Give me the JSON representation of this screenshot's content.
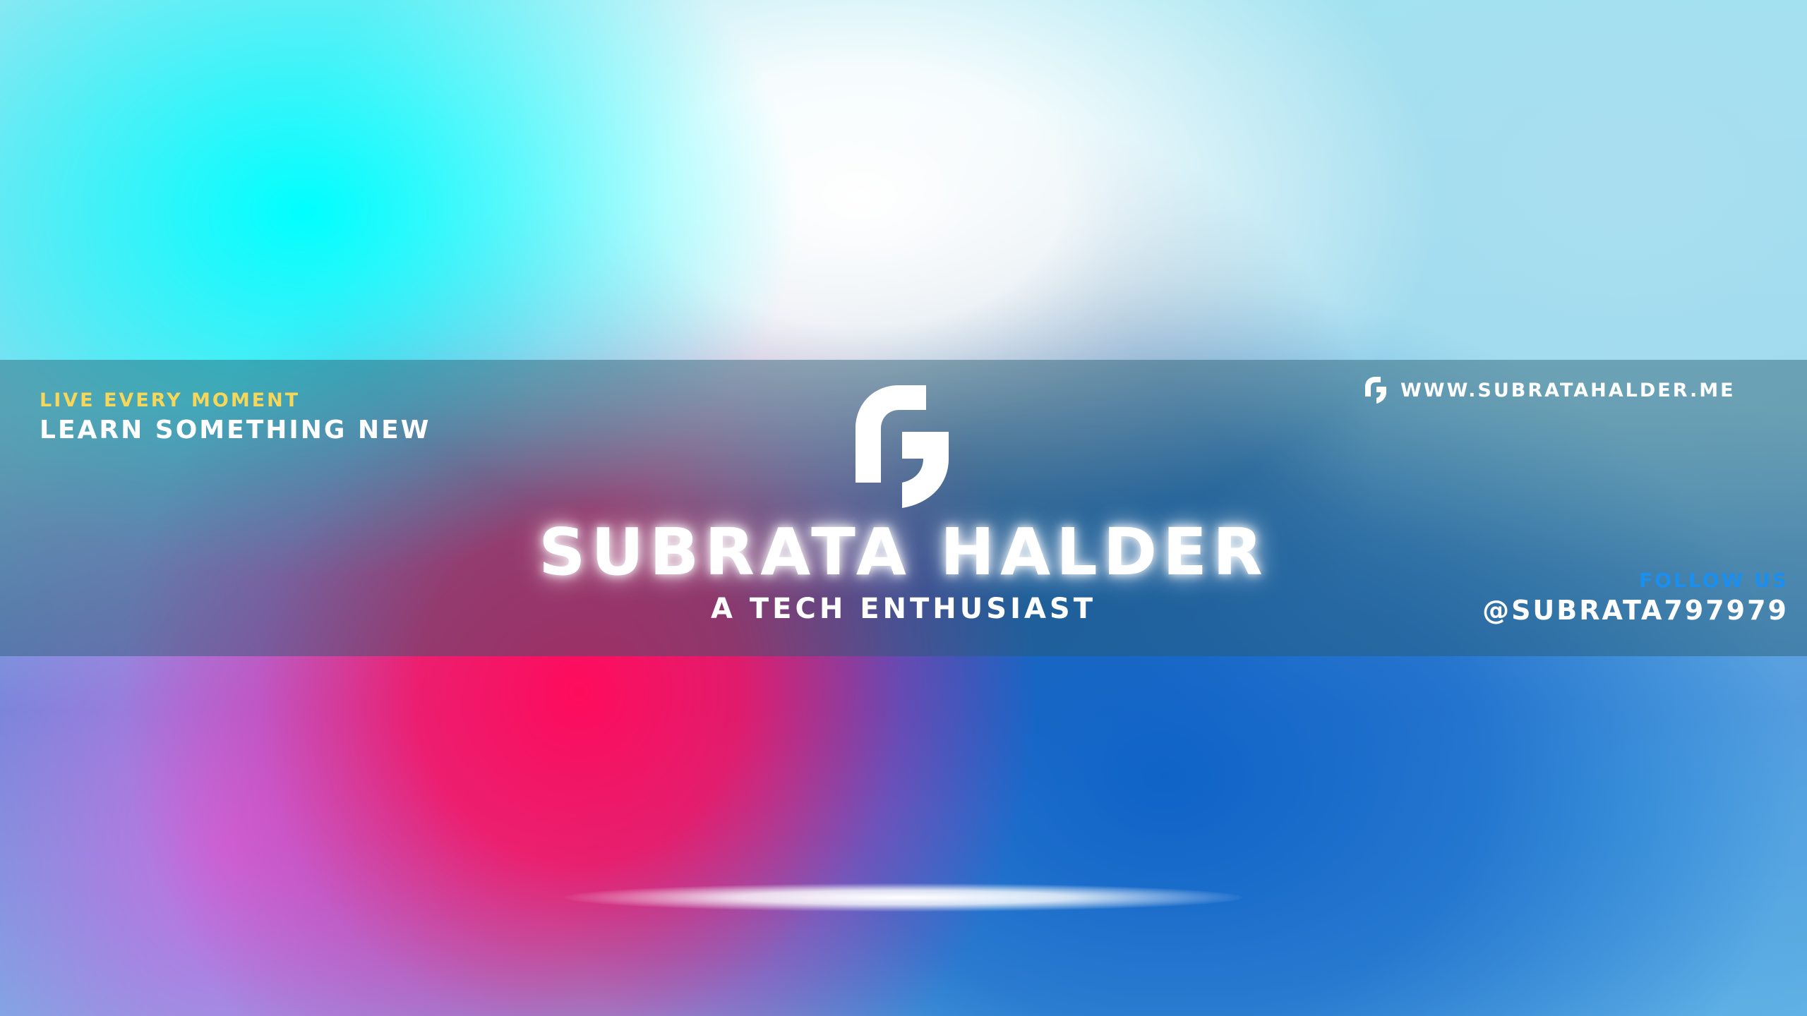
{
  "banner": {
    "tagline_small": "LIVE EVERY MOMENT",
    "tagline_big": "LEARN SOMETHING NEW",
    "website": "WWW.SUBRATAHALDER.ME",
    "name": "SUBRATA HALDER",
    "subtitle": "A TECH ENTHUSIAST",
    "follow_label": "FOLLOW US",
    "handle": "@SUBRATA797979",
    "logo_icon": "sh-logo-icon"
  },
  "colors": {
    "tagline_small": "#f7d75a",
    "follow_label": "#1a8ff0",
    "text": "#ffffff",
    "band": "#285a6e"
  }
}
